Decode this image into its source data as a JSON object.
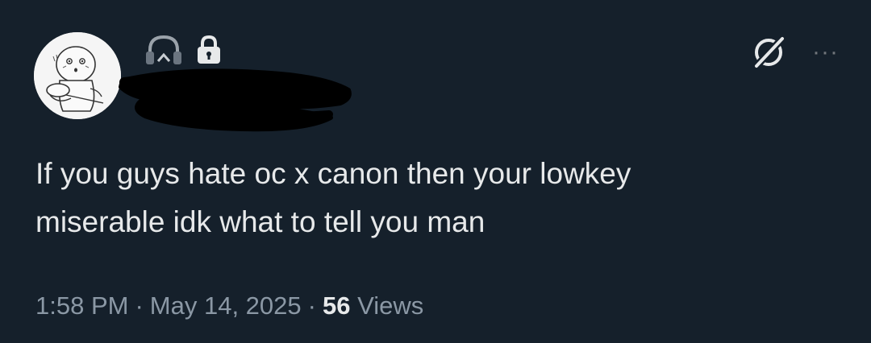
{
  "post": {
    "text_line_1": "If you guys hate oc x canon then your lowkey",
    "text_line_2": "miserable idk what to tell you man",
    "time": "1:58 PM",
    "separator": "·",
    "date": "May 14, 2025",
    "views_count": "56",
    "views_label": "Views"
  },
  "icons": {
    "badge": "headphones-icon",
    "protected": "lock-icon",
    "grok": "grok-icon",
    "more": "more-icon"
  },
  "more_glyph": "···",
  "colors": {
    "background": "#15202b",
    "text_primary": "#e7e9ea",
    "text_secondary": "#8b98a5"
  }
}
